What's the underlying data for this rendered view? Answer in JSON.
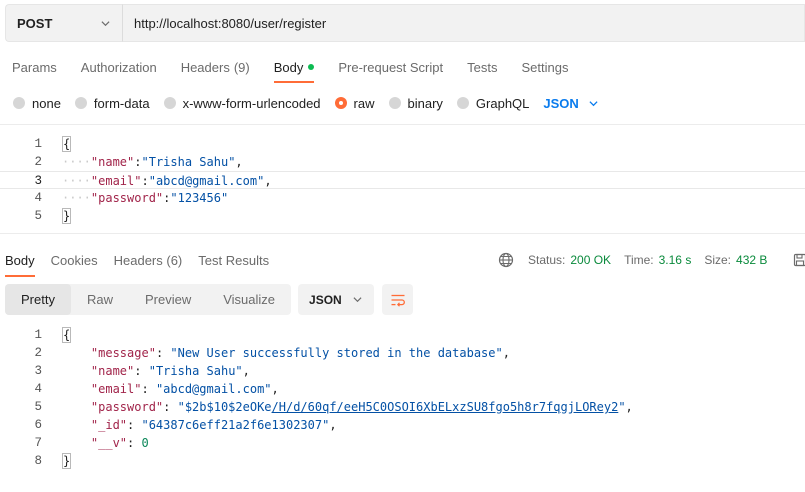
{
  "request": {
    "method": "POST",
    "url": "http://localhost:8080/user/register",
    "tabs": [
      {
        "label": "Params"
      },
      {
        "label": "Authorization"
      },
      {
        "label": "Headers",
        "count": "(9)"
      },
      {
        "label": "Body"
      },
      {
        "label": "Pre-request Script"
      },
      {
        "label": "Tests"
      },
      {
        "label": "Settings"
      }
    ],
    "body_types": [
      "none",
      "form-data",
      "x-www-form-urlencoded",
      "raw",
      "binary",
      "GraphQL"
    ],
    "selected_body_type": "raw",
    "language": "JSON",
    "line_numbers": [
      "1",
      "2",
      "3",
      "4",
      "5"
    ],
    "body_lines": {
      "open": "{",
      "name_key": "\"name\"",
      "name_val": "\"Trisha Sahu\"",
      "email_key": "\"email\"",
      "email_val": "\"abcd@gmail.com\"",
      "password_key": "\"password\"",
      "password_val": "\"123456\"",
      "close": "}"
    }
  },
  "response": {
    "tabs": [
      {
        "label": "Body"
      },
      {
        "label": "Cookies"
      },
      {
        "label": "Headers",
        "count": "(6)"
      },
      {
        "label": "Test Results"
      }
    ],
    "status_label": "Status:",
    "status_value": "200 OK",
    "time_label": "Time:",
    "time_value": "3.16 s",
    "size_label": "Size:",
    "size_value": "432 B",
    "save_label": "Sa",
    "view_modes": [
      "Pretty",
      "Raw",
      "Preview",
      "Visualize"
    ],
    "format": "JSON",
    "line_numbers": [
      "1",
      "2",
      "3",
      "4",
      "5",
      "6",
      "7",
      "8"
    ],
    "body_lines": {
      "open": "{",
      "message_key": "\"message\"",
      "message_val": "\"New User successfully stored in the database\"",
      "name_key": "\"name\"",
      "name_val": "\"Trisha Sahu\"",
      "email_key": "\"email\"",
      "email_val": "\"abcd@gmail.com\"",
      "password_key": "\"password\"",
      "password_val_a": "\"$2b$10$2eOKe",
      "password_val_b": "/H/d/60qf/eeH5C0OSOI6XbELxzSU8fgo5h8r7fqgjLORey2",
      "password_val_c": "\"",
      "id_key": "\"_id\"",
      "id_val": "\"64387c6eff21a2f6e1302307\"",
      "v_key": "\"__v\"",
      "v_val": "0",
      "close": "}"
    }
  },
  "colors": {
    "accent": "#ff6c37",
    "status_ok": "#0a8a3c",
    "link": "#097bed",
    "dot": "#0cbb52"
  }
}
